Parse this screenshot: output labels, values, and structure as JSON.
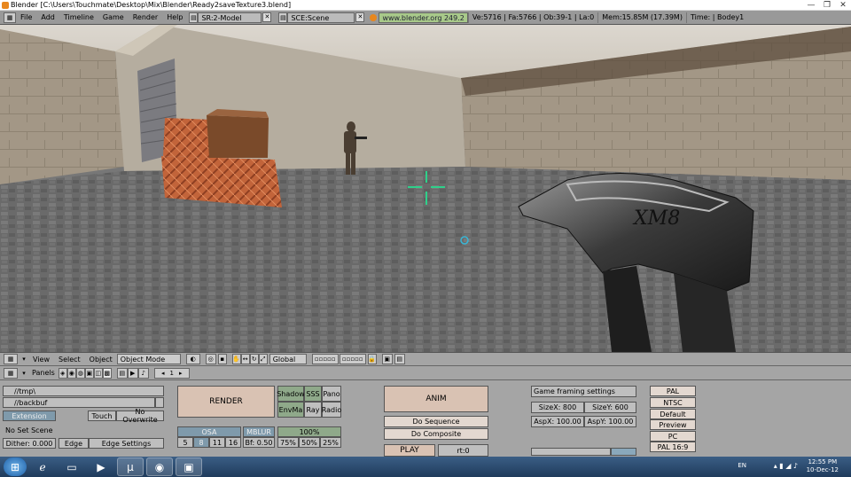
{
  "window": {
    "title": "Blender [C:\\Users\\Touchmate\\Desktop\\Mix\\Blender\\Ready2saveTexture3.blend]",
    "min": "—",
    "max": "❐",
    "close": "✕"
  },
  "info_header": {
    "menus": [
      "File",
      "Add",
      "Timeline",
      "Game",
      "Render",
      "Help"
    ],
    "screen": "SR:2-Model",
    "scene": "SCE:Scene",
    "url": "www.blender.org 249.2",
    "stats": [
      "Ve:5716 | Fa:5766 | Ob:39-1 | La:0",
      "Mem:15.85M (17.39M)",
      "Time: | Bodey1"
    ]
  },
  "viewport_header": {
    "menus": [
      "View",
      "Select",
      "Object"
    ],
    "mode": "Object Mode",
    "orientation": "Global"
  },
  "buttons_header": {
    "panels_label": "Panels",
    "frame": "1"
  },
  "output_panel": {
    "path1": "//tmp\\",
    "path2": "//backbuf",
    "extensions": "Extension",
    "touch": "Touch",
    "no_overwrite": "No Overwrite",
    "set_scene": "No Set Scene",
    "dither": "Dither: 0.000",
    "edge": "Edge",
    "edge_settings": "Edge Settings"
  },
  "render_panel": {
    "render": "RENDER",
    "shadow": "Shadow",
    "sss": "SSS",
    "pano": "Pano",
    "envmap": "EnvMa",
    "ray": "Ray",
    "radio": "Radio",
    "osa": "OSA",
    "mblur": "MBLUR",
    "percent100": "100%",
    "osa_values": [
      "5",
      "8",
      "11",
      "16"
    ],
    "bf": "Bf: 0.50",
    "percents": [
      "75%",
      "50%",
      "25%"
    ]
  },
  "anim_panel": {
    "anim": "ANIM",
    "do_sequence": "Do Sequence",
    "do_composite": "Do Composite",
    "play": "PLAY",
    "rt": "rt:0"
  },
  "format_panel": {
    "title": "Game framing settings",
    "sizex": "SizeX: 800",
    "sizey": "SizeY: 600",
    "aspx": "AspX: 100.00",
    "aspy": "AspY: 100.00"
  },
  "presets": [
    "PAL",
    "NTSC",
    "Default",
    "Preview",
    "PC",
    "PAL 16:9"
  ],
  "taskbar": {
    "lang": "EN",
    "time": "12:55 PM",
    "date": "10-Dec-12"
  },
  "colors": {
    "crosshair": "#2fd08a",
    "header_grey": "#a5a5a5",
    "url_green": "#a8c98a"
  }
}
